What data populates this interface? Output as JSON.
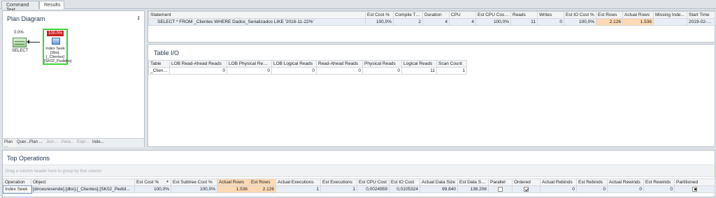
{
  "tabs": [
    {
      "label": "Command Text"
    },
    {
      "label": "Results"
    }
  ],
  "plan": {
    "title": "Plan Diagram",
    "pin_label": "ᵮ",
    "select_node": {
      "pct": "0.0%",
      "label": "SELECT"
    },
    "seek_node": {
      "pct": "100.0%",
      "line1": "Index Seek",
      "line2": "[dbo].[_Clientes]",
      "line3": "[SK02_Pedidos]"
    },
    "bottom_tabs": [
      "Plan ...",
      "Quer...",
      "Plan ...",
      "Join ...",
      "Para...",
      "Expr...",
      "Inde..."
    ]
  },
  "statement": {
    "headers": [
      "Statement",
      "Est Cost %",
      "Compile Time",
      "Duration",
      "CPU",
      "Est CPU Cost %",
      "Reads",
      "Writes",
      "Est IO Cost %",
      "Est Rows",
      "Actual Rows",
      "Missing Inde...",
      "Start Time"
    ],
    "row": [
      "SELECT * FROM _Clientes WHERE Dados_Serializados LIKE '2016-11-22%'",
      "100,0%",
      "2",
      "4",
      "4",
      "100,0%",
      "11",
      "0",
      "100,0%",
      "2.126",
      "1.536",
      "",
      "2019-02-13 0:"
    ]
  },
  "tableio": {
    "title": "Table I/O",
    "headers": [
      "Table",
      "LOB Read-Ahead Reads",
      "LOB Physical Reads",
      "LOB Logical Reads",
      "Read-Ahead Reads",
      "Physical Reads",
      "Logical Reads",
      "Scan Count"
    ],
    "row": [
      "_Clientes",
      "0",
      "0",
      "0",
      "0",
      "0",
      "11",
      "1"
    ]
  },
  "topops": {
    "title": "Top Operations",
    "group_hint": "Drag a column header here to group by that column",
    "headers": [
      "Operation",
      "Object",
      "Est Cost %",
      "Est Subtree Cost %",
      "Actual Rows",
      "Est Rows",
      "Actual Executions",
      "Est Executions",
      "Est CPU Cost",
      "Est IO Cost",
      "Actual Data Size",
      "Est Data Size",
      "Parallel",
      "Ordered",
      "Actual Rebinds",
      "Est Rebinds",
      "Actual Rewinds",
      "Est Rewinds",
      "Partitioned"
    ],
    "row": [
      "Index Seek",
      "[dirceuresende].[dbo].[_Clientes].[SK02_Pedid...",
      "100,0%",
      "100,0%",
      "1.536",
      "2.126",
      "1",
      "1",
      "0,0024959",
      "0,0105324",
      "99.840",
      "138.206",
      "",
      "",
      "0",
      "0",
      "0",
      "0",
      ""
    ]
  },
  "colors": {
    "highlight": "#fbd9b4",
    "accent_red": "#cc1f1f",
    "node_border": "#3bd43b"
  },
  "icons": {
    "sort": "sort-desc-icon",
    "pin": "pin-icon"
  }
}
